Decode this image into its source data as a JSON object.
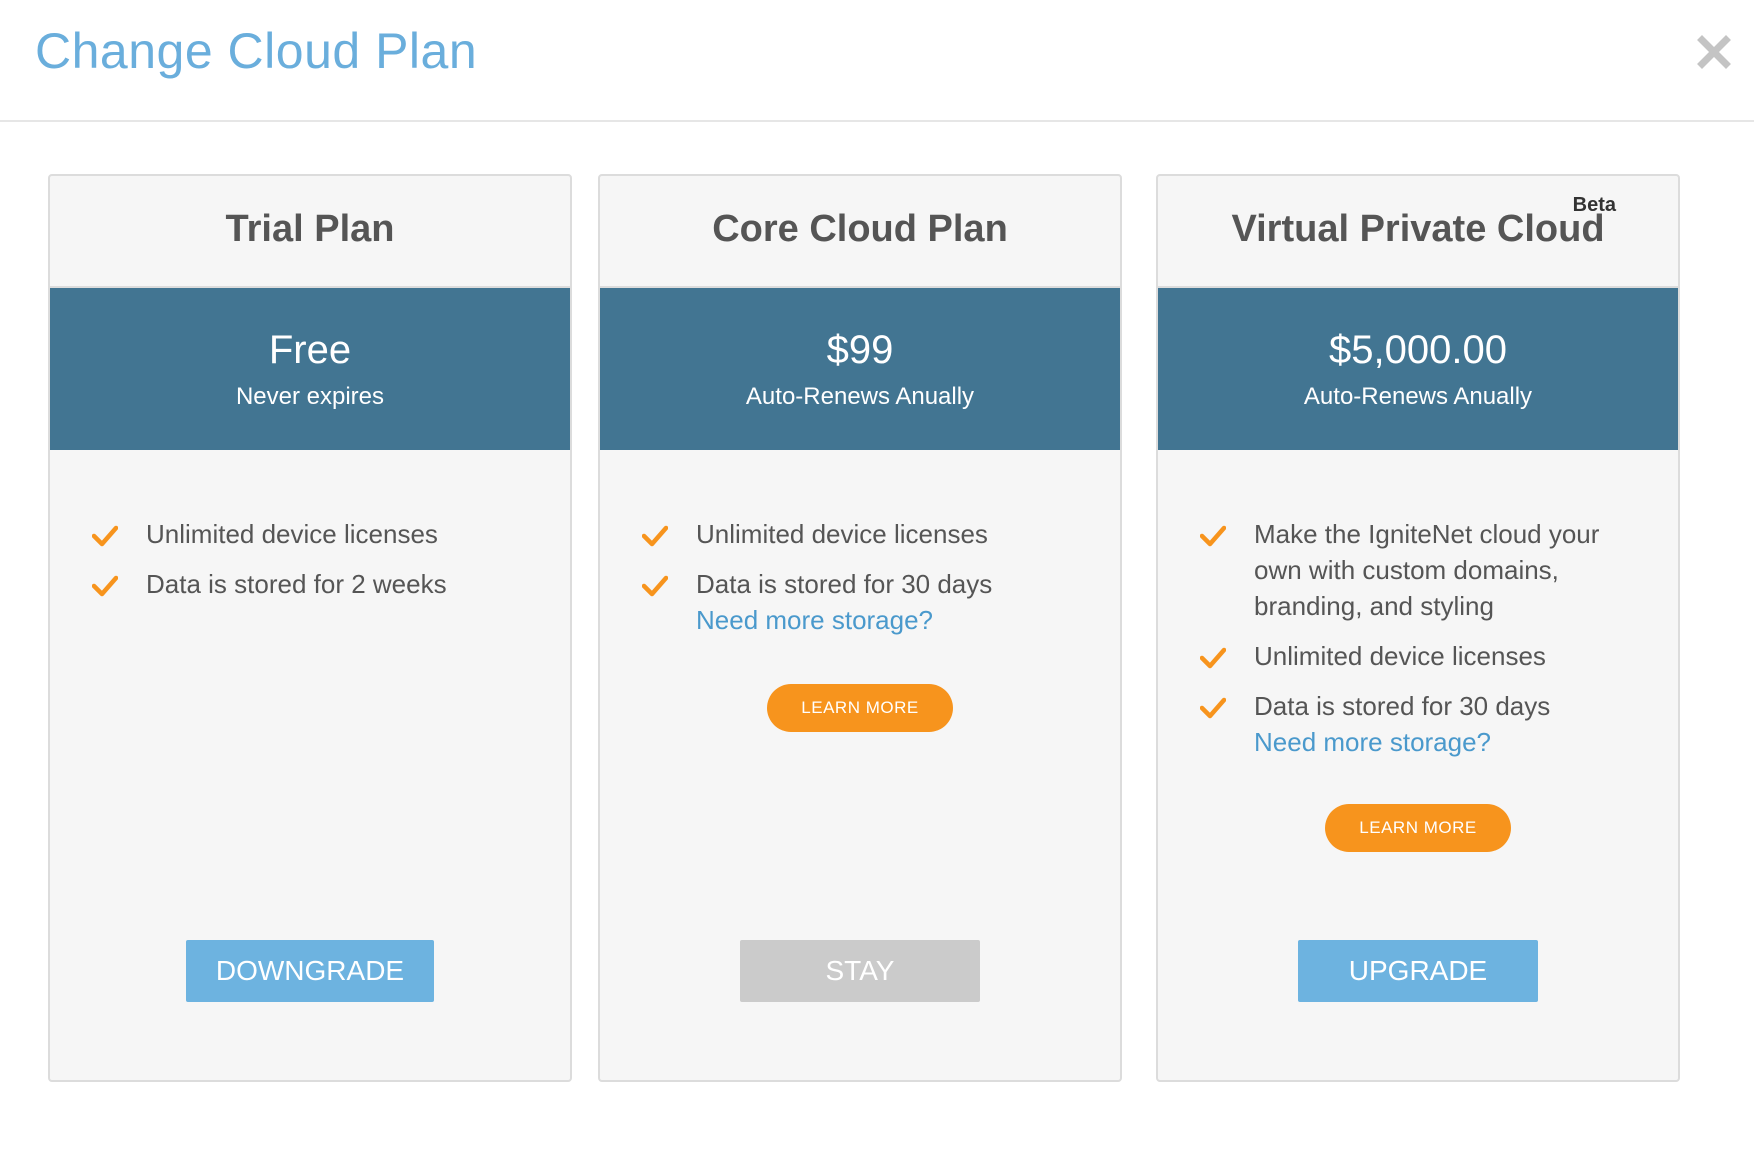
{
  "modal": {
    "title": "Change Cloud Plan"
  },
  "icons": {
    "close": "close-icon",
    "check": "checkmark-icon"
  },
  "colors": {
    "title": "#6aaedc",
    "price_band": "#427592",
    "check": "#f7941d",
    "learn_more": "#f7941d",
    "link": "#4a99cc",
    "primary_button": "#6db3e0",
    "disabled_button": "#cbcbcb"
  },
  "plans": [
    {
      "name": "Trial Plan",
      "price": "Free",
      "renewal": "Never expires",
      "features": [
        "Unlimited device licenses",
        "Data is stored for 2 weeks"
      ],
      "action_label": "DOWNGRADE"
    },
    {
      "name": "Core Cloud Plan",
      "price": "$99",
      "renewal": "Auto-Renews Anually",
      "features": [
        "Unlimited device licenses",
        "Data is stored for 30 days"
      ],
      "storage_link": "Need more storage?",
      "learn_more_label": "LEARN MORE",
      "action_label": "STAY"
    },
    {
      "name": "Virtual Private Cloud",
      "badge": "Beta",
      "price": "$5,000.00",
      "renewal": "Auto-Renews Anually",
      "features": [
        "Make the IgniteNet cloud your own with custom domains, branding, and styling",
        "Unlimited device licenses",
        "Data is stored for 30 days"
      ],
      "storage_link": "Need more storage?",
      "learn_more_label": "LEARN MORE",
      "action_label": "UPGRADE"
    }
  ]
}
